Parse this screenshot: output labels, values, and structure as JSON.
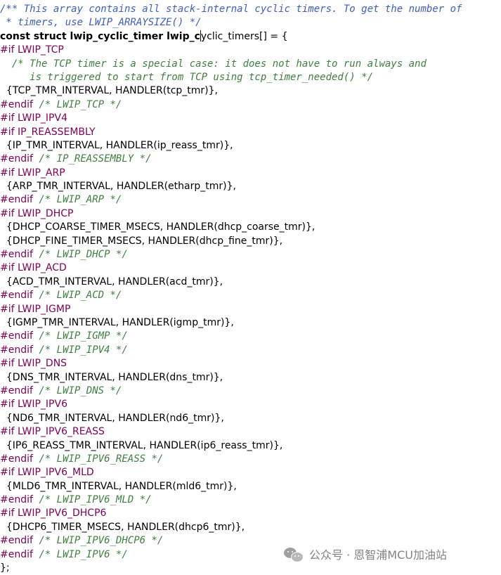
{
  "code": {
    "lines": [
      {
        "style": "doc",
        "text": "/** This array contains all stack-internal cyclic timers. To get the number of"
      },
      {
        "style": "doc",
        "text": " * timers, use LWIP_ARRAYSIZE() */"
      },
      {
        "style": "decl",
        "before_caret": "const struct lwip_cyclic_timer lwip_c",
        "after_caret": "yclic_timers[] = {"
      },
      {
        "style": "pp",
        "text": "#if LWIP_TCP"
      },
      {
        "style": "comment",
        "text": "  /* The TCP timer is a special case: it does not have to run always and"
      },
      {
        "style": "comment",
        "text": "     is triggered to start from TCP using tcp_timer_needed() */"
      },
      {
        "style": "code",
        "text": "  {TCP_TMR_INTERVAL, HANDLER(tcp_tmr)},"
      },
      {
        "style": "endif",
        "directive": "#endif",
        "comment": " /* LWIP_TCP */"
      },
      {
        "style": "pp",
        "text": "#if LWIP_IPV4"
      },
      {
        "style": "pp",
        "text": "#if IP_REASSEMBLY"
      },
      {
        "style": "code",
        "text": "  {IP_TMR_INTERVAL, HANDLER(ip_reass_tmr)},"
      },
      {
        "style": "endif",
        "directive": "#endif",
        "comment": " /* IP_REASSEMBLY */"
      },
      {
        "style": "pp",
        "text": "#if LWIP_ARP"
      },
      {
        "style": "code",
        "text": "  {ARP_TMR_INTERVAL, HANDLER(etharp_tmr)},"
      },
      {
        "style": "endif",
        "directive": "#endif",
        "comment": " /* LWIP_ARP */"
      },
      {
        "style": "pp",
        "text": "#if LWIP_DHCP"
      },
      {
        "style": "code",
        "text": "  {DHCP_COARSE_TIMER_MSECS, HANDLER(dhcp_coarse_tmr)},"
      },
      {
        "style": "code",
        "text": "  {DHCP_FINE_TIMER_MSECS, HANDLER(dhcp_fine_tmr)},"
      },
      {
        "style": "endif",
        "directive": "#endif",
        "comment": " /* LWIP_DHCP */"
      },
      {
        "style": "pp",
        "text": "#if LWIP_ACD"
      },
      {
        "style": "code",
        "text": "  {ACD_TMR_INTERVAL, HANDLER(acd_tmr)},"
      },
      {
        "style": "endif",
        "directive": "#endif",
        "comment": " /* LWIP_ACD */"
      },
      {
        "style": "pp",
        "text": "#if LWIP_IGMP"
      },
      {
        "style": "code",
        "text": "  {IGMP_TMR_INTERVAL, HANDLER(igmp_tmr)},"
      },
      {
        "style": "endif",
        "directive": "#endif",
        "comment": " /* LWIP_IGMP */"
      },
      {
        "style": "endif",
        "directive": "#endif",
        "comment": " /* LWIP_IPV4 */"
      },
      {
        "style": "pp",
        "text": "#if LWIP_DNS"
      },
      {
        "style": "code",
        "text": "  {DNS_TMR_INTERVAL, HANDLER(dns_tmr)},"
      },
      {
        "style": "endif",
        "directive": "#endif",
        "comment": " /* LWIP_DNS */"
      },
      {
        "style": "pp",
        "text": "#if LWIP_IPV6"
      },
      {
        "style": "code",
        "text": "  {ND6_TMR_INTERVAL, HANDLER(nd6_tmr)},"
      },
      {
        "style": "pp",
        "text": "#if LWIP_IPV6_REASS"
      },
      {
        "style": "code",
        "text": "  {IP6_REASS_TMR_INTERVAL, HANDLER(ip6_reass_tmr)},"
      },
      {
        "style": "endif",
        "directive": "#endif",
        "comment": " /* LWIP_IPV6_REASS */"
      },
      {
        "style": "pp",
        "text": "#if LWIP_IPV6_MLD"
      },
      {
        "style": "code",
        "text": "  {MLD6_TMR_INTERVAL, HANDLER(mld6_tmr)},"
      },
      {
        "style": "endif",
        "directive": "#endif",
        "comment": " /* LWIP_IPV6_MLD */"
      },
      {
        "style": "pp",
        "text": "#if LWIP_IPV6_DHCP6"
      },
      {
        "style": "code",
        "text": "  {DHCP6_TIMER_MSECS, HANDLER(dhcp6_tmr)},"
      },
      {
        "style": "endif",
        "directive": "#endif",
        "comment": " /* LWIP_IPV6_DHCP6 */"
      },
      {
        "style": "endif",
        "directive": "#endif",
        "comment": " /* LWIP_IPV6 */"
      },
      {
        "style": "code",
        "text": "};"
      }
    ]
  },
  "watermark": {
    "text": "公众号 · 恩智浦MCU加油站",
    "icon": "wechat-icon"
  },
  "colors": {
    "doc_comment": "#3f5fbf",
    "comment": "#3f7f3f",
    "preprocessor": "#7f0055",
    "code": "#000000"
  }
}
